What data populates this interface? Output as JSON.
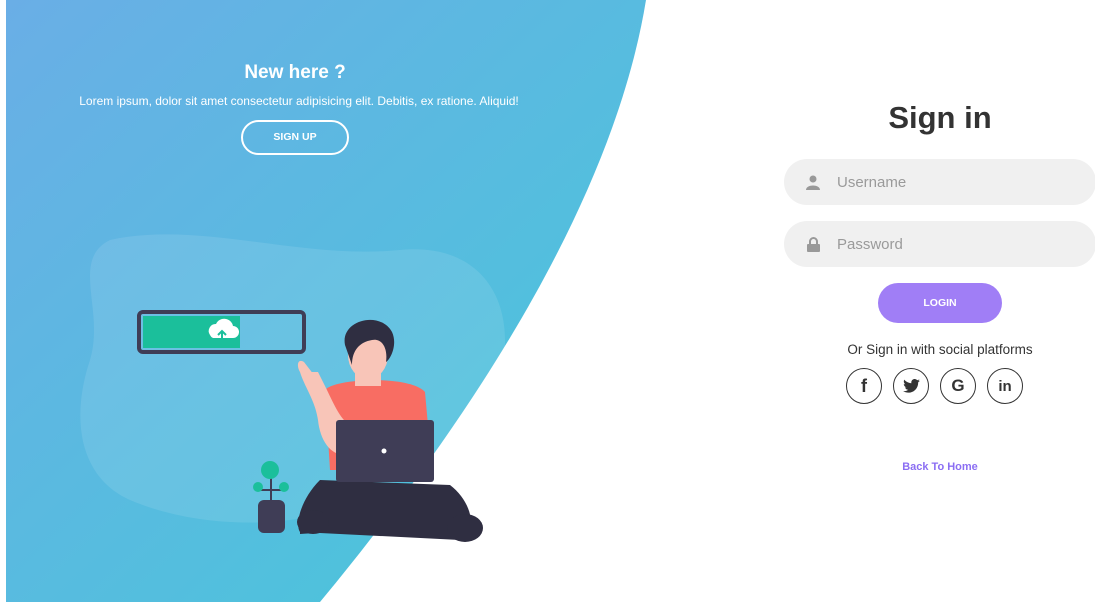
{
  "left_panel": {
    "title": "New here ?",
    "text": "Lorem ipsum, dolor sit amet consectetur adipisicing elit. Debitis, ex ratione. Aliquid!",
    "signup_label": "SIGN UP",
    "colors": {
      "gradient_start": "#6aaee6",
      "gradient_end": "#4bc9dd"
    }
  },
  "signin": {
    "title": "Sign in",
    "username_placeholder": "Username",
    "password_placeholder": "Password",
    "login_label": "LOGIN",
    "social_text": "Or Sign in with social platforms",
    "social": [
      {
        "label": "f",
        "icon": "facebook-icon"
      },
      {
        "label": "twitter",
        "icon": "twitter-icon"
      },
      {
        "label": "G",
        "icon": "google-icon"
      },
      {
        "label": "in",
        "icon": "linkedin-icon"
      }
    ],
    "back_label": "Back To Home",
    "accent": "#a07ef6"
  }
}
